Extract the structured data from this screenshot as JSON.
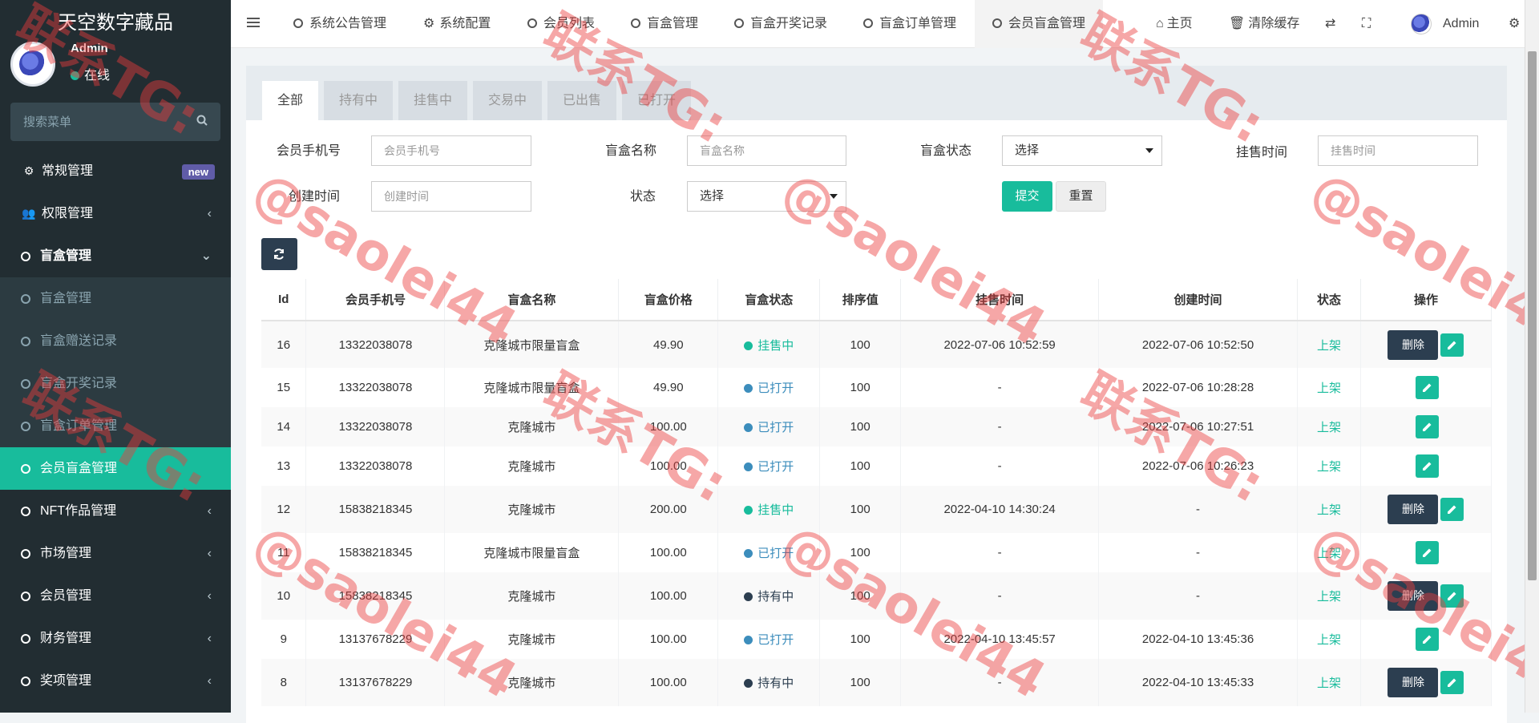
{
  "app": {
    "title": "天空数字藏品"
  },
  "user": {
    "name": "Admin",
    "status": "在线"
  },
  "search": {
    "placeholder": "搜索菜单"
  },
  "sidebar": {
    "items": [
      {
        "label": "常规管理",
        "badge": "new"
      },
      {
        "label": "权限管理"
      },
      {
        "label": "盲盒管理"
      },
      {
        "label": "盲盒管理"
      },
      {
        "label": "盲盒赠送记录"
      },
      {
        "label": "盲盒开奖记录"
      },
      {
        "label": "盲盒订单管理"
      },
      {
        "label": "会员盲盒管理"
      },
      {
        "label": "NFT作品管理"
      },
      {
        "label": "市场管理"
      },
      {
        "label": "会员管理"
      },
      {
        "label": "财务管理"
      },
      {
        "label": "奖项管理"
      }
    ]
  },
  "topnav": {
    "tabs": [
      "系统公告管理",
      "系统配置",
      "会员列表",
      "盲盒管理",
      "盲盒开奖记录",
      "盲盒订单管理",
      "会员盲盒管理"
    ],
    "home": "主页",
    "clear_cache": "清除缓存",
    "admin": "Admin"
  },
  "filter_tabs": [
    "全部",
    "持有中",
    "挂售中",
    "交易中",
    "已出售",
    "已打开"
  ],
  "form": {
    "phone_label": "会员手机号",
    "phone_placeholder": "会员手机号",
    "name_label": "盲盒名称",
    "name_placeholder": "盲盒名称",
    "box_status_label": "盲盒状态",
    "box_status_value": "选择",
    "sell_time_label": "挂售时间",
    "sell_time_placeholder": "挂售时间",
    "create_time_label": "创建时间",
    "create_time_placeholder": "创建时间",
    "status_label": "状态",
    "status_value": "选择",
    "submit": "提交",
    "reset": "重置"
  },
  "table": {
    "headers": [
      "Id",
      "会员手机号",
      "盲盒名称",
      "盲盒价格",
      "盲盒状态",
      "排序值",
      "挂售时间",
      "创建时间",
      "状态",
      "操作"
    ],
    "delete_label": "删除",
    "rows": [
      {
        "id": "16",
        "phone": "13322038078",
        "name": "克隆城市限量盲盒",
        "price": "49.90",
        "box_status": "挂售中",
        "sort": "100",
        "sell_time": "2022-07-06 10:52:59",
        "create_time": "2022-07-06 10:52:50",
        "status": "上架"
      },
      {
        "id": "15",
        "phone": "13322038078",
        "name": "克隆城市限量盲盒",
        "price": "49.90",
        "box_status": "已打开",
        "sort": "100",
        "sell_time": "-",
        "create_time": "2022-07-06 10:28:28",
        "status": "上架"
      },
      {
        "id": "14",
        "phone": "13322038078",
        "name": "克隆城市",
        "price": "100.00",
        "box_status": "已打开",
        "sort": "100",
        "sell_time": "-",
        "create_time": "2022-07-06 10:27:51",
        "status": "上架"
      },
      {
        "id": "13",
        "phone": "13322038078",
        "name": "克隆城市",
        "price": "100.00",
        "box_status": "已打开",
        "sort": "100",
        "sell_time": "-",
        "create_time": "2022-07-06 10:26:23",
        "status": "上架"
      },
      {
        "id": "12",
        "phone": "15838218345",
        "name": "克隆城市",
        "price": "200.00",
        "box_status": "挂售中",
        "sort": "100",
        "sell_time": "2022-04-10 14:30:24",
        "create_time": "-",
        "status": "上架"
      },
      {
        "id": "11",
        "phone": "15838218345",
        "name": "克隆城市限量盲盒",
        "price": "100.00",
        "box_status": "已打开",
        "sort": "100",
        "sell_time": "-",
        "create_time": "-",
        "status": "上架"
      },
      {
        "id": "10",
        "phone": "15838218345",
        "name": "克隆城市",
        "price": "100.00",
        "box_status": "持有中",
        "sort": "100",
        "sell_time": "-",
        "create_time": "-",
        "status": "上架"
      },
      {
        "id": "9",
        "phone": "13137678229",
        "name": "克隆城市",
        "price": "100.00",
        "box_status": "已打开",
        "sort": "100",
        "sell_time": "2022-04-10 13:45:57",
        "create_time": "2022-04-10 13:45:36",
        "status": "上架"
      },
      {
        "id": "8",
        "phone": "13137678229",
        "name": "克隆城市",
        "price": "100.00",
        "box_status": "持有中",
        "sort": "100",
        "sell_time": "-",
        "create_time": "2022-04-10 13:45:33",
        "status": "上架"
      }
    ]
  },
  "watermark": {
    "line1": "联系TG:",
    "line2": "@saolei44"
  },
  "colors": {
    "sidebar_bg": "#222d32",
    "accent": "#18bc9c",
    "dark_btn": "#2c3e50",
    "status_blue": "#3c8dbc"
  }
}
